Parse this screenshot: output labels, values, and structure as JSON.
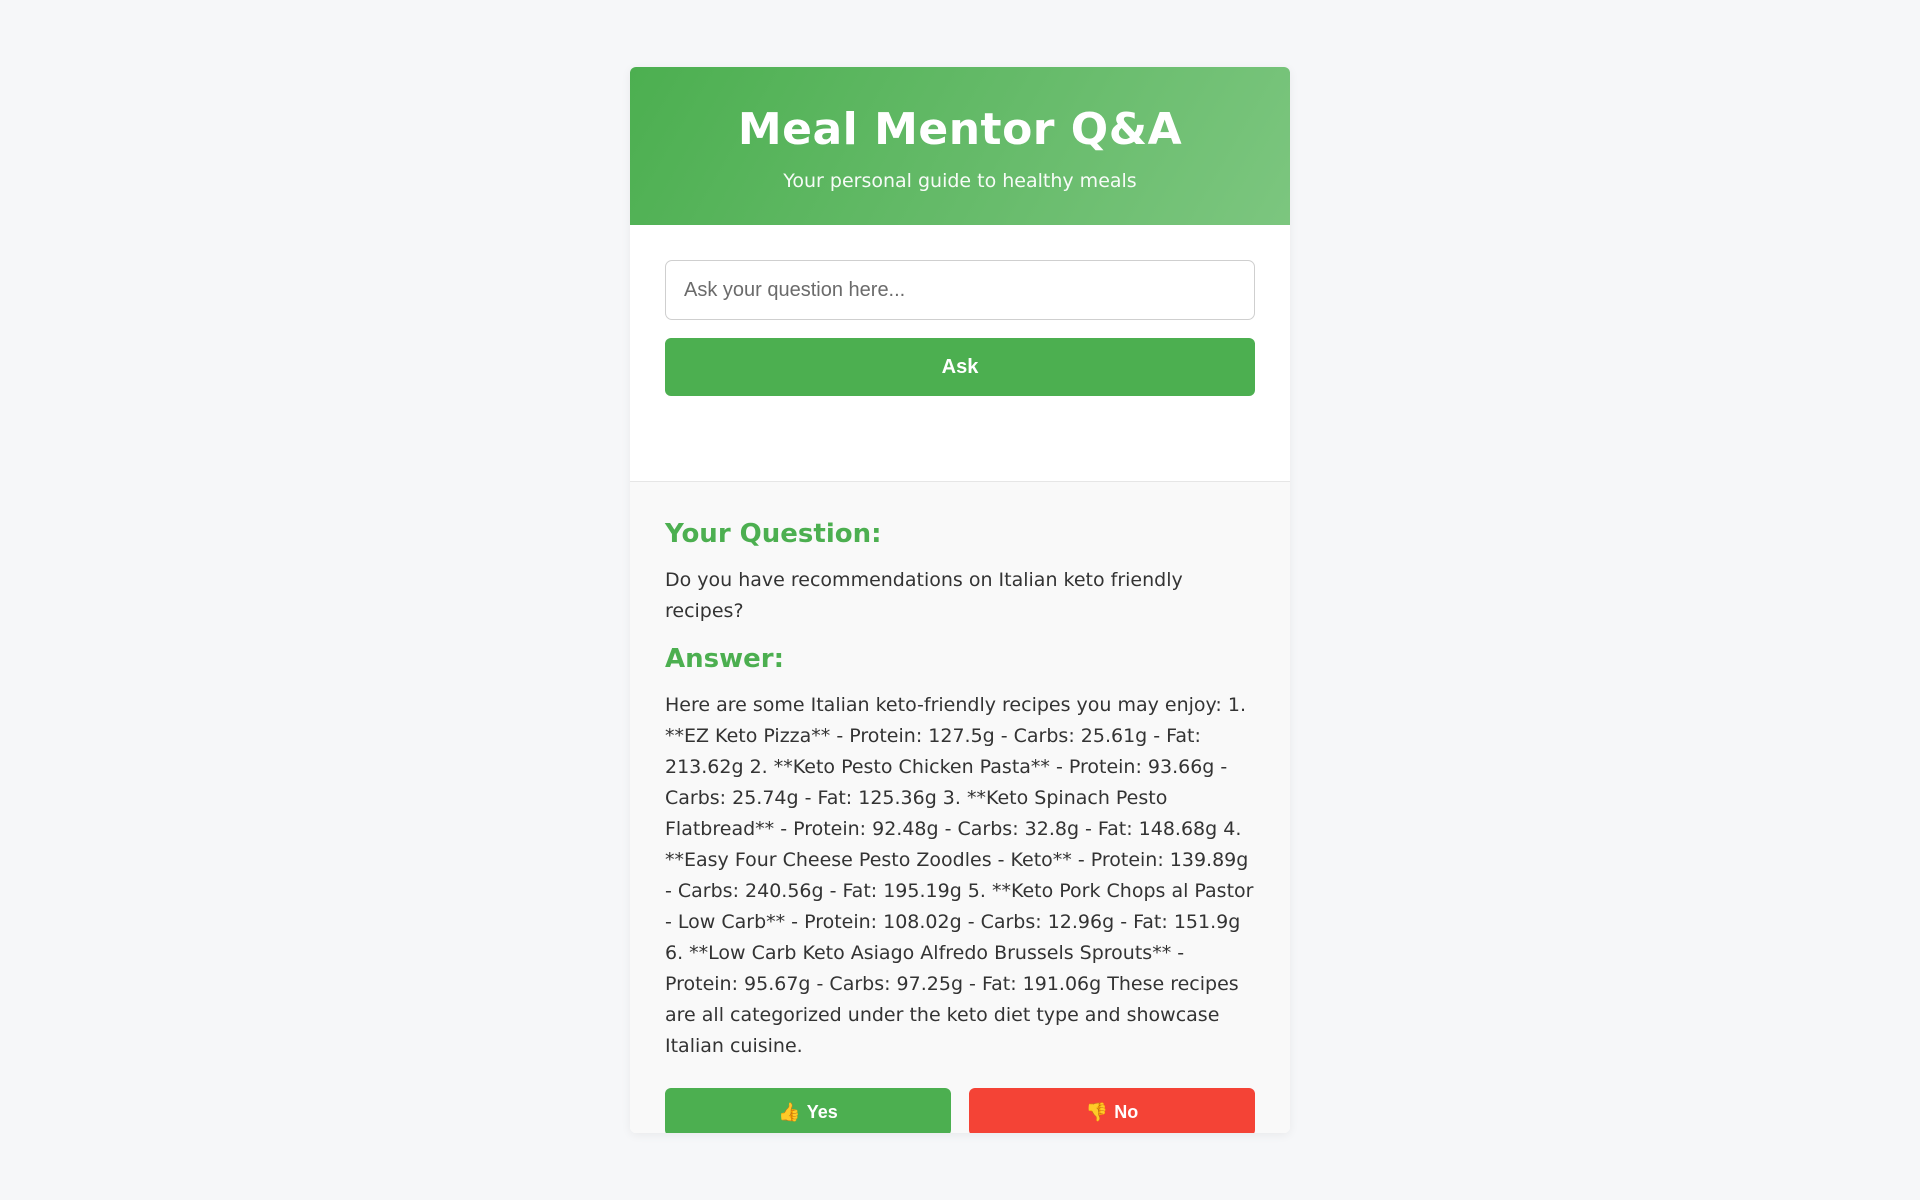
{
  "header": {
    "title": "Meal Mentor Q&A",
    "subtitle": "Your personal guide to healthy meals"
  },
  "ask": {
    "placeholder": "Ask your question here...",
    "value": "",
    "button_label": "Ask"
  },
  "result": {
    "question_heading": "Your Question:",
    "question_text": "Do you have recommendations on Italian keto friendly recipes?",
    "answer_heading": "Answer:",
    "answer_text": "Here are some Italian keto-friendly recipes you may enjoy: 1. **EZ Keto Pizza** - Protein: 127.5g - Carbs: 25.61g - Fat: 213.62g 2. **Keto Pesto Chicken Pasta** - Protein: 93.66g - Carbs: 25.74g - Fat: 125.36g 3. **Keto Spinach Pesto Flatbread** - Protein: 92.48g - Carbs: 32.8g - Fat: 148.68g 4. **Easy Four Cheese Pesto Zoodles - Keto** - Protein: 139.89g - Carbs: 240.56g - Fat: 195.19g 5. **Keto Pork Chops al Pastor - Low Carb** - Protein: 108.02g - Carbs: 12.96g - Fat: 151.9g 6. **Low Carb Keto Asiago Alfredo Brussels Sprouts** - Protein: 95.67g - Carbs: 97.25g - Fat: 191.06g These recipes are all categorized under the keto diet type and showcase Italian cuisine."
  },
  "feedback": {
    "yes_icon": "👍",
    "yes_label": "Yes",
    "no_icon": "👎",
    "no_label": "No"
  },
  "colors": {
    "accent": "#4caf50",
    "danger": "#f44336",
    "background": "#f6f7f9"
  }
}
